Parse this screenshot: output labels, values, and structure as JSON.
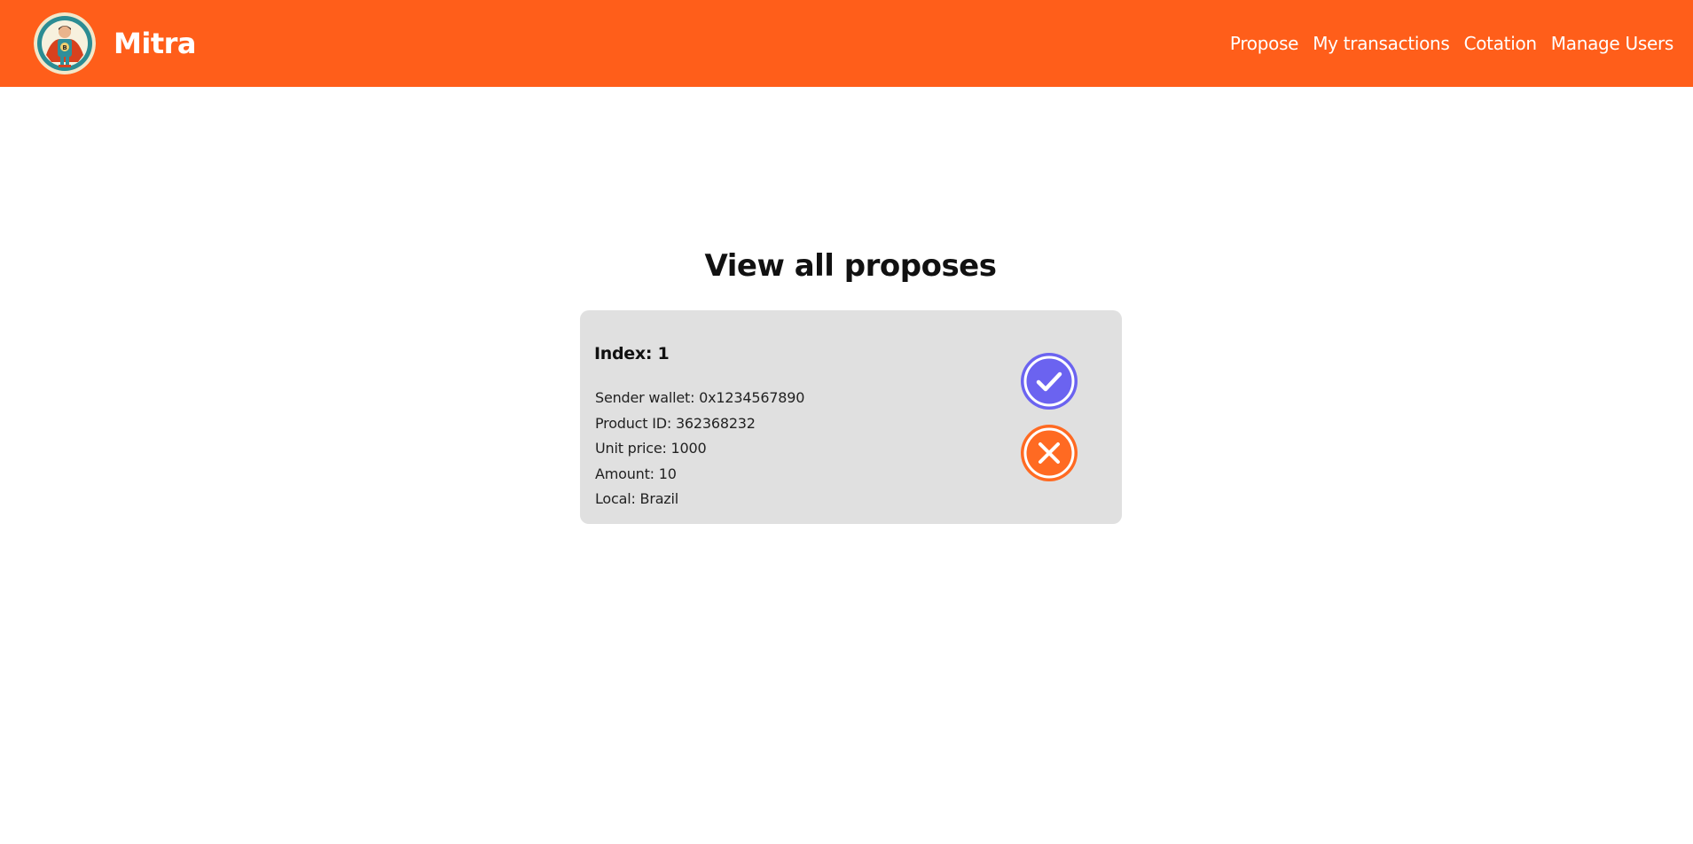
{
  "app": {
    "name": "Mitra",
    "brand_color": "#ff5e1a"
  },
  "nav": {
    "items": [
      {
        "label": "Propose"
      },
      {
        "label": "My transactions"
      },
      {
        "label": "Cotation"
      },
      {
        "label": "Manage Users"
      }
    ]
  },
  "page": {
    "title": "View all proposes"
  },
  "proposals": [
    {
      "index_label": "Index: 1",
      "sender_wallet": "Sender wallet: 0x1234567890",
      "product_id": "Product ID: 362368232",
      "unit_price": "Unit price: 1000",
      "amount": "Amount: 10",
      "local": "Local: Brazil",
      "accept_icon": "check-circle-icon",
      "accept_color": "#6b63f0",
      "reject_icon": "x-circle-icon",
      "reject_color": "#ff6a22"
    }
  ]
}
